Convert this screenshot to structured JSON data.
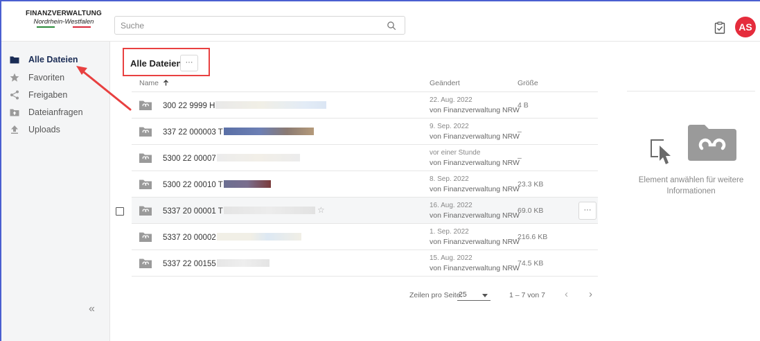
{
  "header": {
    "logo_top": "FINANZVERWALTUNG",
    "logo_bottom": "Nordrhein-Westfalen",
    "search_placeholder": "Suche",
    "avatar_initials": "AS"
  },
  "sidebar": {
    "items": [
      {
        "label": "Alle Dateien",
        "icon": "folder-icon",
        "active": true
      },
      {
        "label": "Favoriten",
        "icon": "star-icon",
        "active": false
      },
      {
        "label": "Freigaben",
        "icon": "share-icon",
        "active": false
      },
      {
        "label": "Dateianfragen",
        "icon": "folder-upload-icon",
        "active": false
      },
      {
        "label": "Uploads",
        "icon": "upload-icon",
        "active": false
      }
    ],
    "collapse_label": "«"
  },
  "main": {
    "title": "Alle Dateien",
    "more_label": "···",
    "columns": {
      "name": "Name",
      "changed": "Geändert",
      "size": "Größe"
    },
    "rows": [
      {
        "name": "300 22 9999 H",
        "date": "22. Aug. 2022",
        "by": "von Finanzverwaltung NRW",
        "size": "4 B"
      },
      {
        "name": "337 22 000003 T",
        "date": "9. Sep. 2022",
        "by": "von Finanzverwaltung NRW",
        "size": "–"
      },
      {
        "name": "5300 22 00007",
        "date": "vor einer Stunde",
        "by": "von Finanzverwaltung NRW",
        "size": "–"
      },
      {
        "name": "5300 22 00010 T",
        "date": "8. Sep. 2022",
        "by": "von Finanzverwaltung NRW",
        "size": "23.3 KB"
      },
      {
        "name": "5337 20 00001 T",
        "date": "16. Aug. 2022",
        "by": "von Finanzverwaltung NRW",
        "size": "69.0 KB"
      },
      {
        "name": "5337 20 00002",
        "date": "1. Sep. 2022",
        "by": "von Finanzverwaltung NRW",
        "size": "216.6 KB"
      },
      {
        "name": "5337 22 00155",
        "date": "15. Aug. 2022",
        "by": "von Finanzverwaltung NRW",
        "size": "74.5 KB"
      }
    ],
    "row_more_label": "···",
    "star_glyph": "☆"
  },
  "pagination": {
    "rows_label": "Zeilen pro Seite:",
    "rows_value": "25",
    "range": "1 – 7 von 7",
    "prev": "‹",
    "next": "›"
  },
  "details": {
    "empty_text": "Element anwählen für weitere Informationen"
  },
  "colors": {
    "accent": "#e52c3c",
    "annotation": "#e84040",
    "folder_grey": "#9a9a9a",
    "frame_blue": "#4a5fd0"
  }
}
